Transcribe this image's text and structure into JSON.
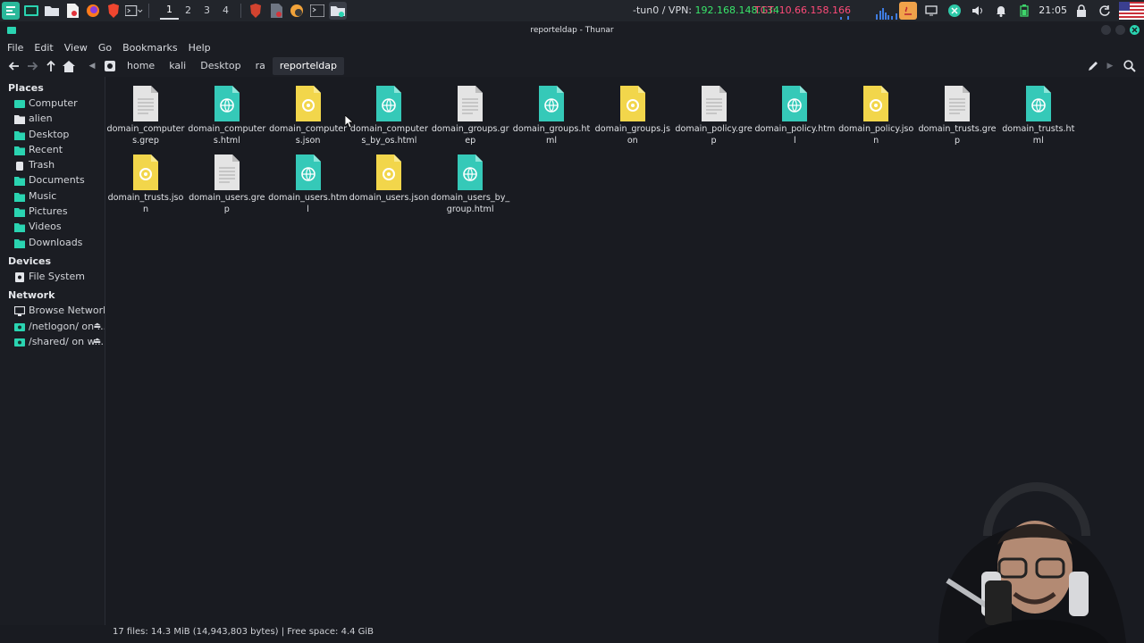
{
  "taskbar": {
    "workspaces": [
      "1",
      "2",
      "3",
      "4"
    ],
    "active_workspace": "1",
    "vpn_prefix": "-tun0 / VPN: ",
    "vpn_ip": "192.168.148.134",
    "target": "TGT: 10.66.158.166",
    "clock": "21:05",
    "icons": [
      "kali-menu-icon",
      "terminal-icon",
      "folder-icon",
      "pdf-icon",
      "firefox-icon",
      "brave-icon",
      "terminal-dropdown-icon",
      "burp-icon",
      "document-icon",
      "bloodhound-icon",
      "terminal-icon-2",
      "file-manager-icon",
      "java-icon",
      "display-icon",
      "messaging-icon",
      "volume-icon",
      "bell-icon",
      "battery-icon",
      "lock-icon",
      "refresh-icon",
      "us-flag-icon"
    ]
  },
  "window": {
    "title": "reporteldap - Thunar"
  },
  "menu": [
    "File",
    "Edit",
    "View",
    "Go",
    "Bookmarks",
    "Help"
  ],
  "path": {
    "crumbs": [
      "home",
      "kali",
      "Desktop",
      "ra",
      "reporteldap"
    ]
  },
  "sidebar": {
    "places_title": "Places",
    "places": [
      {
        "label": "Computer",
        "icon": "computer-icon"
      },
      {
        "label": "alien",
        "icon": "home-folder-icon"
      },
      {
        "label": "Desktop",
        "icon": "desktop-icon"
      },
      {
        "label": "Recent",
        "icon": "recent-icon"
      },
      {
        "label": "Trash",
        "icon": "trash-icon"
      },
      {
        "label": "Documents",
        "icon": "documents-folder-icon"
      },
      {
        "label": "Music",
        "icon": "music-folder-icon"
      },
      {
        "label": "Pictures",
        "icon": "pictures-folder-icon"
      },
      {
        "label": "Videos",
        "icon": "videos-folder-icon"
      },
      {
        "label": "Downloads",
        "icon": "downloads-folder-icon"
      }
    ],
    "devices_title": "Devices",
    "devices": [
      {
        "label": "File System",
        "icon": "drive-icon"
      }
    ],
    "network_title": "Network",
    "network": [
      {
        "label": "Browse Network",
        "icon": "network-icon"
      },
      {
        "label": "/netlogon/ on ...",
        "icon": "share-icon"
      },
      {
        "label": "/shared/ on w...",
        "icon": "share-icon"
      }
    ]
  },
  "files": [
    {
      "name": "domain_computers.grep",
      "type": "text"
    },
    {
      "name": "domain_computers.html",
      "type": "html"
    },
    {
      "name": "domain_computers.json",
      "type": "json"
    },
    {
      "name": "domain_computers_by_os.html",
      "type": "html"
    },
    {
      "name": "domain_groups.grep",
      "type": "text"
    },
    {
      "name": "domain_groups.html",
      "type": "html"
    },
    {
      "name": "domain_groups.json",
      "type": "json"
    },
    {
      "name": "domain_policy.grep",
      "type": "text"
    },
    {
      "name": "domain_policy.html",
      "type": "html"
    },
    {
      "name": "domain_policy.json",
      "type": "json"
    },
    {
      "name": "domain_trusts.grep",
      "type": "text"
    },
    {
      "name": "domain_trusts.html",
      "type": "html"
    },
    {
      "name": "domain_trusts.json",
      "type": "json"
    },
    {
      "name": "domain_users.grep",
      "type": "text"
    },
    {
      "name": "domain_users.html",
      "type": "html"
    },
    {
      "name": "domain_users.json",
      "type": "json"
    },
    {
      "name": "domain_users_by_group.html",
      "type": "html"
    }
  ],
  "status": {
    "text": "17 files: 14.3 MiB (14,943,803 bytes)  |  Free space: 4.4 GiB"
  },
  "colors": {
    "html_file": "#35c9b8",
    "json_file": "#f2d64b",
    "text_file": "#e4e4e4",
    "vpn_ip": "#39e56a",
    "target": "#ff4b79",
    "accent": "#2ad4b1"
  }
}
